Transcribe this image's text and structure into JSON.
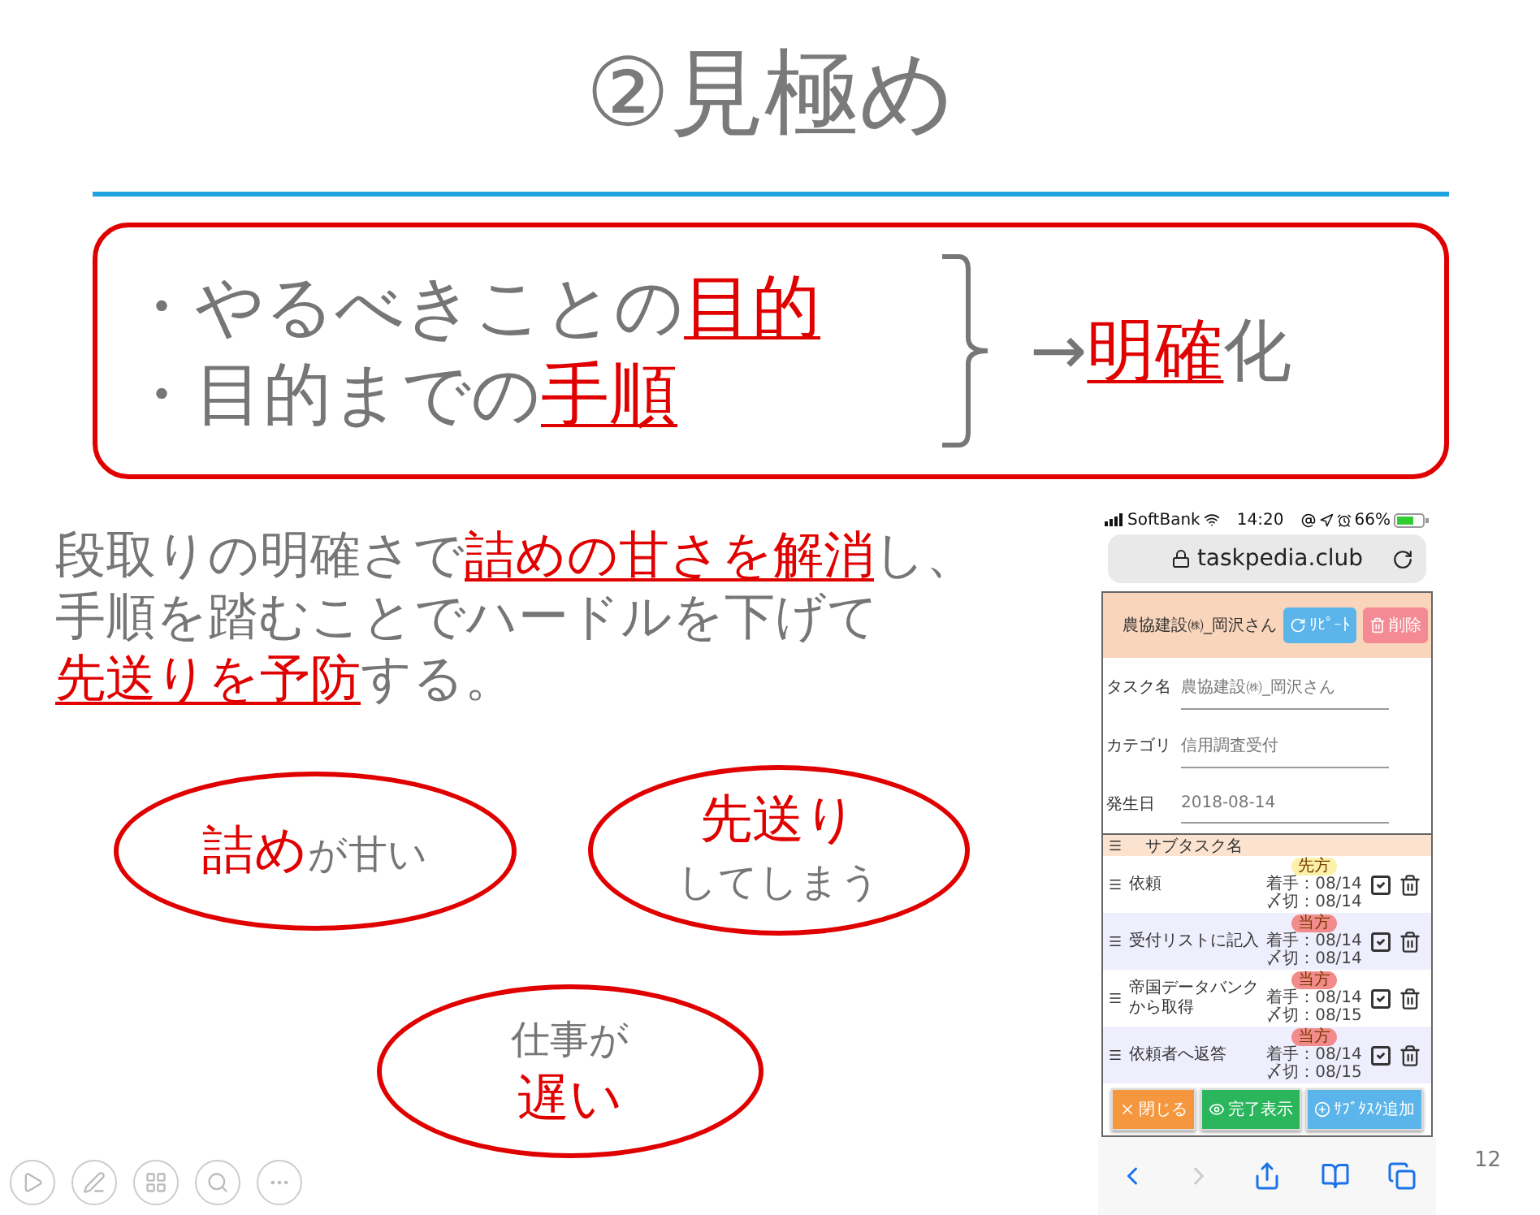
{
  "slide": {
    "title": "②見極め",
    "page_number": "12"
  },
  "summary_box": {
    "items": [
      [
        {
          "text": "・やるべきことの",
          "emphasis": false
        },
        {
          "text": "目的",
          "emphasis": true
        }
      ],
      [
        {
          "text": "・目的までの",
          "emphasis": false
        },
        {
          "text": "手順",
          "emphasis": true
        }
      ]
    ],
    "result": [
      {
        "text": "→",
        "emphasis": false
      },
      {
        "text": "明確",
        "emphasis": true
      },
      {
        "text": "化",
        "emphasis": false
      }
    ]
  },
  "paragraph": {
    "lines": [
      [
        {
          "text": "段取りの明確さで",
          "emphasis": false
        },
        {
          "text": "詰めの甘さを解消",
          "emphasis": true
        },
        {
          "text": "し、",
          "emphasis": false
        }
      ],
      [
        {
          "text": "手順を踏むことでハードルを下げて",
          "emphasis": false
        }
      ],
      [
        {
          "text": "先送りを予防",
          "emphasis": true
        },
        {
          "text": "する。",
          "emphasis": false
        }
      ]
    ]
  },
  "ellipses": [
    {
      "lines": [
        [
          {
            "text": "詰め",
            "emphasis": true
          },
          {
            "text": "が甘い",
            "emphasis": false
          }
        ]
      ]
    },
    {
      "lines": [
        [
          {
            "text": "先送り",
            "emphasis": true
          }
        ],
        [
          {
            "text": "してしまう",
            "emphasis": false
          }
        ]
      ]
    },
    {
      "lines": [
        [
          {
            "text": "仕事が",
            "emphasis": false
          }
        ],
        [
          {
            "text": "遅い",
            "emphasis": true
          }
        ]
      ]
    }
  ],
  "phone": {
    "carrier": "SoftBank",
    "time": "14:20",
    "battery": "66%",
    "url": "taskpedia.club",
    "header": {
      "title": "農協建設㈱_岡沢さん",
      "buttons": [
        {
          "label": "ﾘﾋﾟｰﾄ",
          "kind": "repeat"
        },
        {
          "label": "削除",
          "kind": "delete"
        }
      ]
    },
    "fields": [
      {
        "label": "タスク名",
        "value": "農協建設㈱_岡沢さん"
      },
      {
        "label": "カテゴリ",
        "value": "信用調査受付"
      },
      {
        "label": "発生日",
        "value": "2018-08-14"
      }
    ],
    "subtask_header": "サブタスク名",
    "subtasks": [
      {
        "name": "依頼",
        "badge": "先方",
        "color": "#fbf1a8",
        "start": "着手：08/14",
        "due": "〆切：08/14"
      },
      {
        "name": "受付リストに記入",
        "badge": "当方",
        "color": "#f28b8b",
        "start": "着手：08/14",
        "due": "〆切：08/14"
      },
      {
        "name": "帝国データバンクから取得",
        "badge": "当方",
        "color": "#f28b8b",
        "start": "着手：08/14",
        "due": "〆切：08/15"
      },
      {
        "name": "依頼者へ返答",
        "badge": "当方",
        "color": "#f28b8b",
        "start": "着手：08/14",
        "due": "〆切：08/15"
      }
    ],
    "actions": [
      {
        "label": "閉じる",
        "kind": "close"
      },
      {
        "label": "完了表示",
        "kind": "show"
      },
      {
        "label": "ｻﾌﾞﾀｽｸ追加",
        "kind": "add"
      }
    ]
  }
}
